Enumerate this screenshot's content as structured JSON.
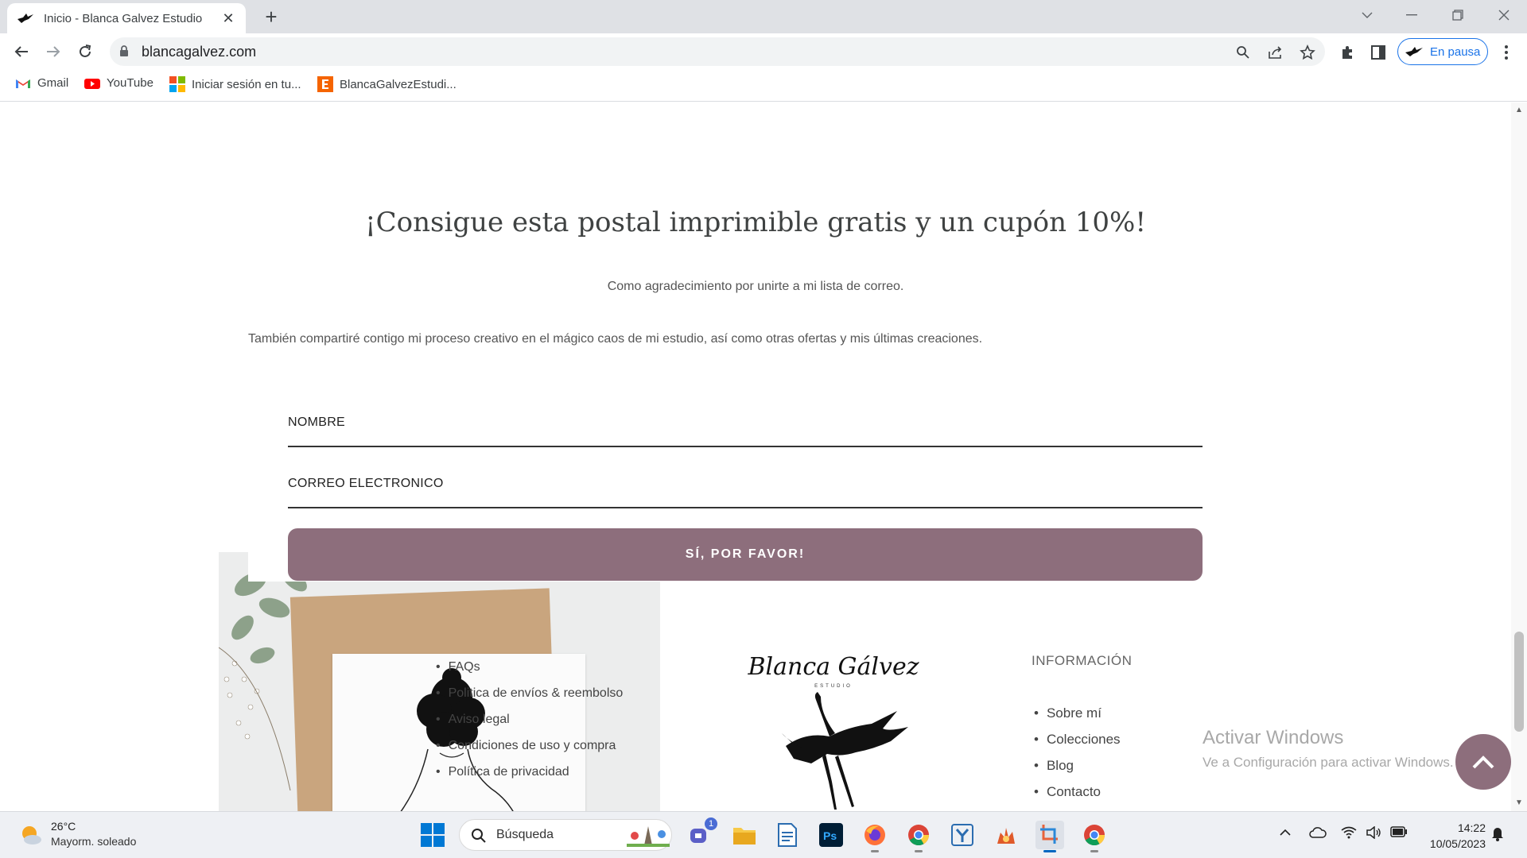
{
  "browser": {
    "tab_title": "Inicio - Blanca Galvez Estudio",
    "url": "blancagalvez.com",
    "profile_status": "En pausa"
  },
  "bookmarks": [
    {
      "label": "Gmail",
      "icon": "gmail-icon"
    },
    {
      "label": "YouTube",
      "icon": "youtube-icon"
    },
    {
      "label": "Iniciar sesión en tu...",
      "icon": "microsoft-icon"
    },
    {
      "label": "BlancaGalvezEstudi...",
      "icon": "etsy-icon"
    }
  ],
  "newsletter": {
    "headline": "¡Consigue esta postal imprimible gratis y un cupón 10%!",
    "subtitle": "Como agradecimiento por unirte a mi lista de correo.",
    "description": "También compartiré contigo mi proceso creativo en el mágico caos de mi estudio, así como otras ofertas y mis últimas creaciones.",
    "name_label": "NOMBRE",
    "email_label": "CORREO ELECTRONICO",
    "submit_label": "SÍ, POR FAVOR!"
  },
  "footer": {
    "legal_links": [
      "FAQs",
      "Politica de envíos & reembolso",
      "Aviso legal",
      "Condiciones de uso y compra",
      "Política de privacidad"
    ],
    "logo_text": "Blanca Gálvez",
    "logo_sub": "ESTUDIO",
    "info_title": "INFORMACIÓN",
    "info_links": [
      "Sobre mí",
      "Colecciones",
      "Blog",
      "Contacto"
    ]
  },
  "activation": {
    "title": "Activar Windows",
    "subtitle": "Ve a Configuración para activar Windows."
  },
  "taskbar": {
    "weather_temp": "26°C",
    "weather_desc": "Mayorm. soleado",
    "search_placeholder": "Búsqueda",
    "chat_badge": "1",
    "time": "14:22",
    "date": "10/05/2023"
  },
  "colors": {
    "accent": "#8d6e7c",
    "link_blue": "#1a73e8"
  }
}
